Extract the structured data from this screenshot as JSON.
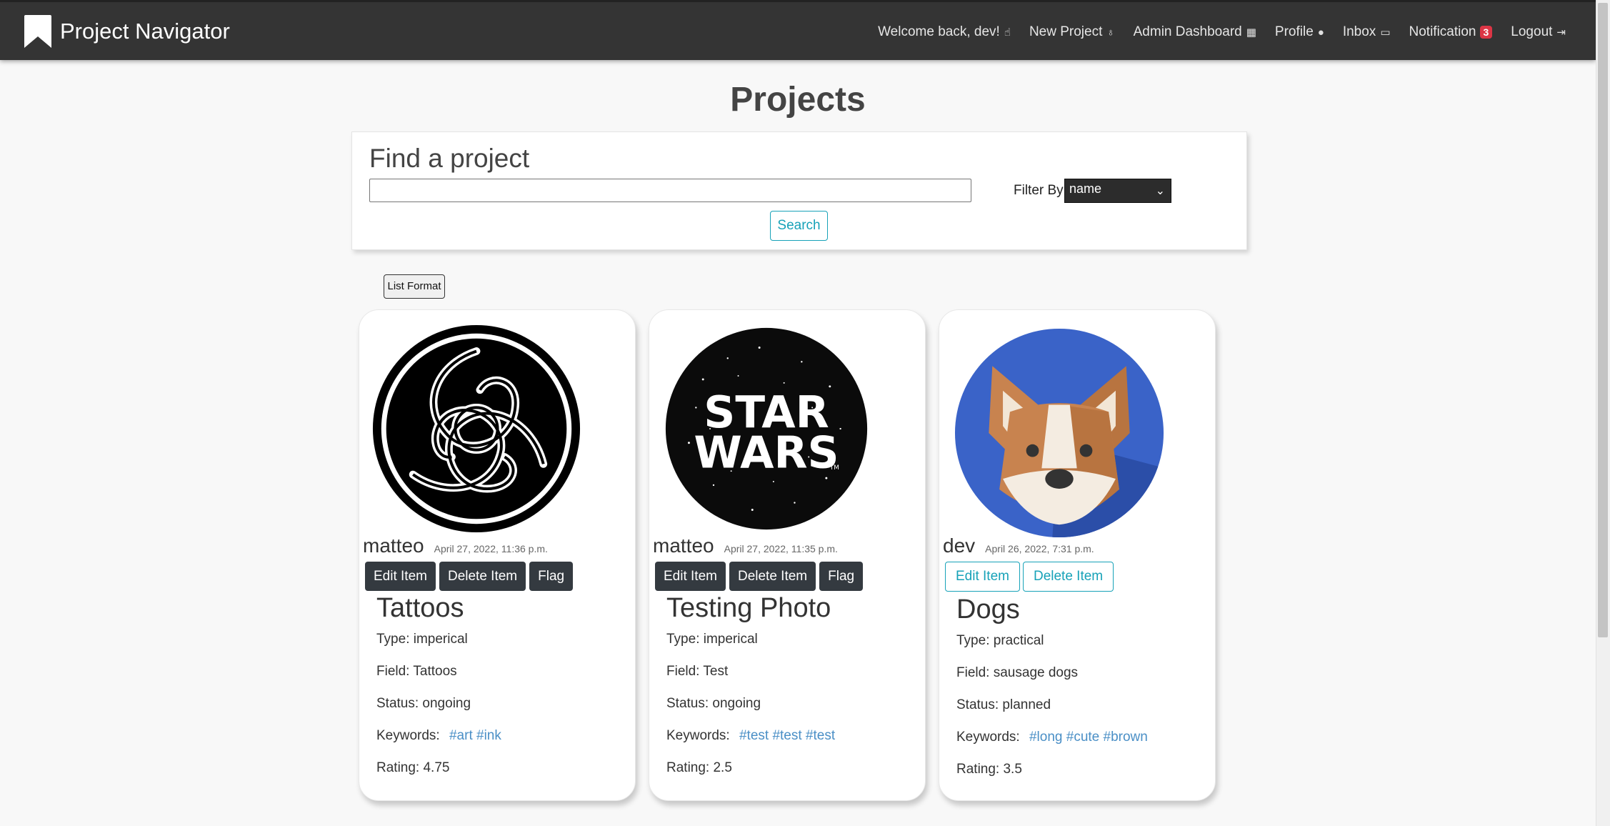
{
  "navbar": {
    "brand": "Project Navigator",
    "items": [
      {
        "label": "Welcome back, dev!",
        "icon": "hand-pointer-icon",
        "glyph": "☝"
      },
      {
        "label": "New Project",
        "icon": "lightbulb-icon",
        "glyph": "♁"
      },
      {
        "label": "Admin Dashboard",
        "icon": "table-icon",
        "glyph": "▦"
      },
      {
        "label": "Profile",
        "icon": "user-icon",
        "glyph": "●"
      },
      {
        "label": "Inbox",
        "icon": "inbox-icon",
        "glyph": "▭"
      },
      {
        "label": "Notification",
        "icon": "bell-icon",
        "badge": "3"
      },
      {
        "label": "Logout",
        "icon": "logout-icon",
        "glyph": "⇥"
      }
    ]
  },
  "page": {
    "title": "Projects"
  },
  "search": {
    "title": "Find a project",
    "input_value": "",
    "filter_label": "Filter By:",
    "filter_selected": "name",
    "button": "Search"
  },
  "list_format_button": "List Format",
  "cards": [
    {
      "image": "celtic-knot-image",
      "author": "matteo",
      "date": "April 27, 2022, 11:36 p.m.",
      "buttons": [
        "Edit Item",
        "Delete Item",
        "Flag"
      ],
      "title": "Tattoos",
      "type": "Type: imperical",
      "field": "Field: Tattoos",
      "status": "Status: ongoing",
      "keywords_label": "Keywords:",
      "keywords": "#art #ink",
      "rating": "Rating: 4.75"
    },
    {
      "image": "star-wars-logo-image",
      "image_text": [
        "STAR",
        "WARS",
        "TM"
      ],
      "author": "matteo",
      "date": "April 27, 2022, 11:35 p.m.",
      "buttons": [
        "Edit Item",
        "Delete Item",
        "Flag"
      ],
      "title": "Testing Photo",
      "type": "Type: imperical",
      "field": "Field: Test",
      "status": "Status: ongoing",
      "keywords_label": "Keywords:",
      "keywords": "#test #test #test",
      "rating": "Rating: 2.5"
    },
    {
      "image": "corgi-image",
      "author": "dev",
      "date": "April 26, 2022, 7:31 p.m.",
      "buttons": [
        "Edit Item",
        "Delete Item"
      ],
      "title": "Dogs",
      "type": "Type: practical",
      "field": "Field: sausage dogs",
      "status": "Status: planned",
      "keywords_label": "Keywords:",
      "keywords": "#long #cute #brown",
      "rating": "Rating: 3.5"
    }
  ],
  "colors": {
    "navbar": "#343434",
    "accent": "#17a2b8",
    "badge": "#dc3545",
    "keyword": "#4a8fc6"
  }
}
